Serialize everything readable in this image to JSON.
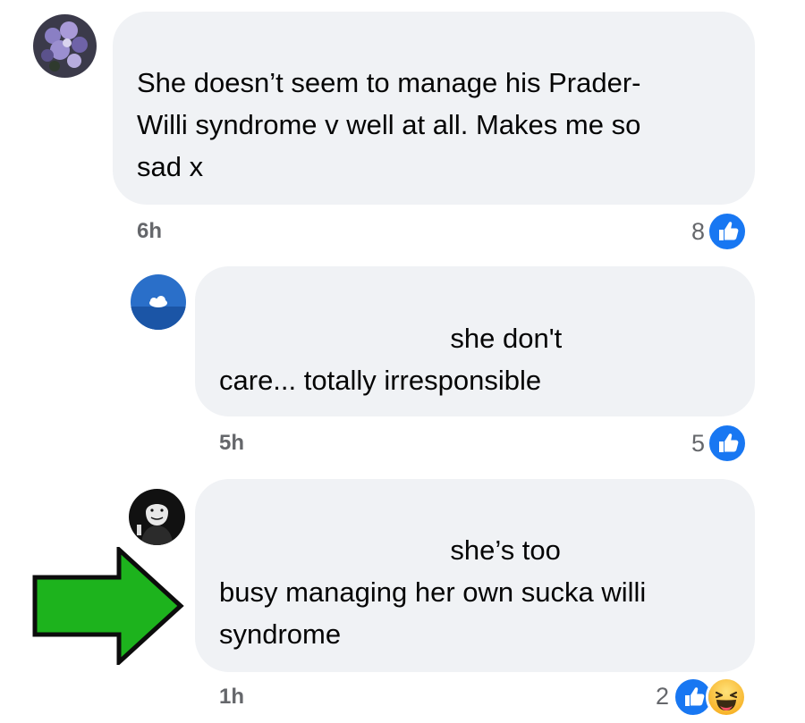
{
  "comments": [
    {
      "text": "She doesn’t seem to manage his Prader-\nWilli syndrome v well at all. Makes me so\nsad x",
      "time": "6h",
      "reaction_count": "8",
      "reactions": [
        "like-icon"
      ]
    },
    {
      "text": "                              she don't\ncare... totally irresponsible",
      "time": "5h",
      "reaction_count": "5",
      "reactions": [
        "like-icon"
      ]
    },
    {
      "text": "                              she’s too\nbusy managing her own sucka willi\nsyndrome",
      "time": "1h",
      "reaction_count": "2",
      "reactions": [
        "like-icon",
        "haha-icon"
      ]
    }
  ],
  "colors": {
    "bubble": "#f0f2f5",
    "like_blue": "#1877f2",
    "meta_gray": "#65676b",
    "arrow_green": "#1db31d"
  }
}
